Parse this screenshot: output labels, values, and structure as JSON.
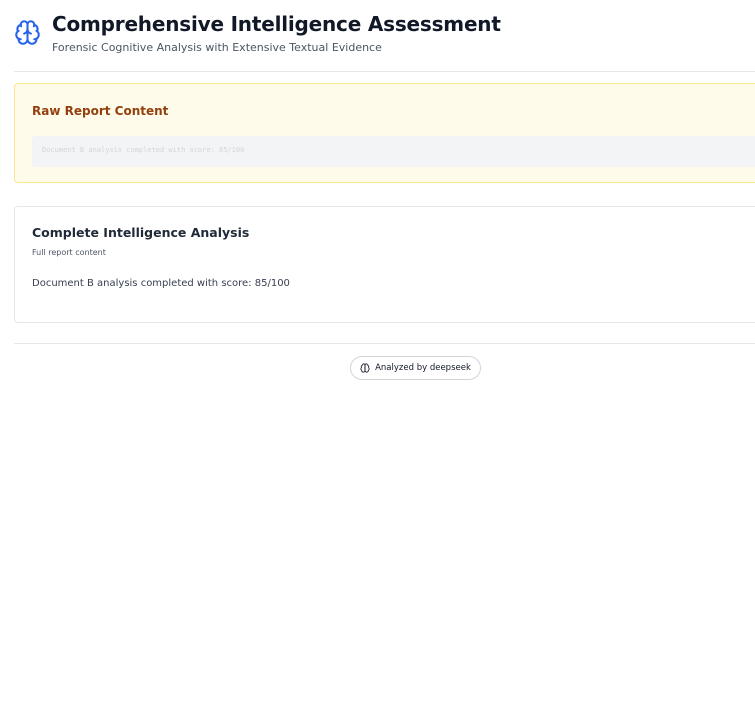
{
  "header": {
    "title": "Comprehensive Intelligence Assessment",
    "subtitle": "Forensic Cognitive Analysis with Extensive Textual Evidence",
    "icon": "brain-icon"
  },
  "raw_report": {
    "title": "Raw Report Content",
    "content": "Document B analysis completed with score: 85/100"
  },
  "analysis": {
    "title": "Complete Intelligence Analysis",
    "subtitle": "Full report content",
    "body": "Document B analysis completed with score: 85/100"
  },
  "footer": {
    "badge_label": "Analyzed by deepseek",
    "icon": "brain-icon"
  },
  "colors": {
    "accent": "#2563eb",
    "raw_card_bg": "#fffbeb",
    "raw_card_border": "#fde68a",
    "raw_title": "#92400e"
  }
}
